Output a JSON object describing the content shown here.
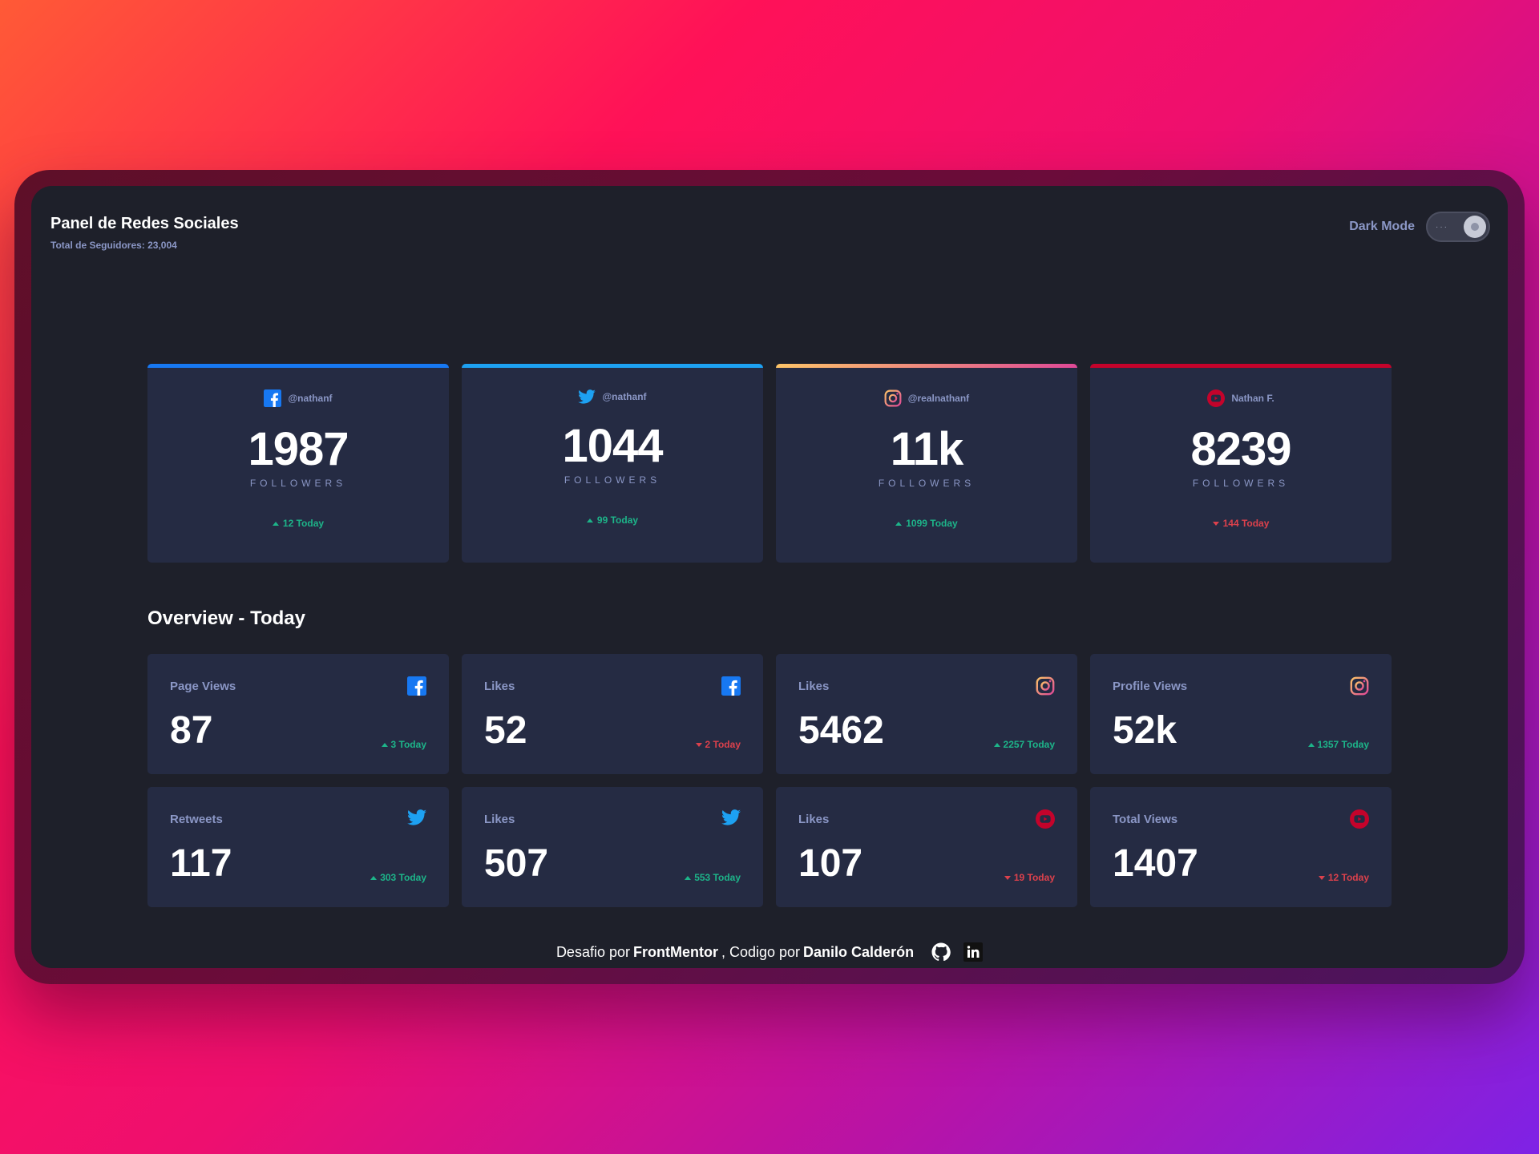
{
  "header": {
    "title": "Panel de Redes Sociales",
    "subtitle": "Total de Seguidores: 23,004",
    "mode_label": "Dark Mode"
  },
  "colors": {
    "facebook": "#1778f2",
    "twitter": "#1da1f2",
    "youtube": "#c4032b",
    "up": "#1db489",
    "down": "#dc414c"
  },
  "cards": [
    {
      "platform": "facebook",
      "handle": "@nathanf",
      "count": "1987",
      "label": "FOLLOWERS",
      "today": "12 Today",
      "trend": "up"
    },
    {
      "platform": "twitter",
      "handle": "@nathanf",
      "count": "1044",
      "label": "FOLLOWERS",
      "today": "99 Today",
      "trend": "up"
    },
    {
      "platform": "instagram",
      "handle": "@realnathanf",
      "count": "11k",
      "label": "FOLLOWERS",
      "today": "1099 Today",
      "trend": "up"
    },
    {
      "platform": "youtube",
      "handle": "Nathan F.",
      "count": "8239",
      "label": "FOLLOWERS",
      "today": "144 Today",
      "trend": "down"
    }
  ],
  "overview": {
    "title": "Overview - Today",
    "items": [
      {
        "label": "Page Views",
        "platform": "facebook",
        "value": "87",
        "change": "3 Today",
        "trend": "up"
      },
      {
        "label": "Likes",
        "platform": "facebook",
        "value": "52",
        "change": "2 Today",
        "trend": "down"
      },
      {
        "label": "Likes",
        "platform": "instagram",
        "value": "5462",
        "change": "2257 Today",
        "trend": "up"
      },
      {
        "label": "Profile Views",
        "platform": "instagram",
        "value": "52k",
        "change": "1357 Today",
        "trend": "up"
      },
      {
        "label": "Retweets",
        "platform": "twitter",
        "value": "117",
        "change": "303 Today",
        "trend": "up"
      },
      {
        "label": "Likes",
        "platform": "twitter",
        "value": "507",
        "change": "553 Today",
        "trend": "up"
      },
      {
        "label": "Likes",
        "platform": "youtube",
        "value": "107",
        "change": "19 Today",
        "trend": "down"
      },
      {
        "label": "Total Views",
        "platform": "youtube",
        "value": "1407",
        "change": "12 Today",
        "trend": "down"
      }
    ]
  },
  "footer": {
    "prefix": "Desafio por",
    "brand": "FrontMentor",
    "middle": ", Codigo por",
    "author": "Danilo Calderón",
    "icons": [
      "github-icon",
      "linkedin-icon"
    ]
  }
}
